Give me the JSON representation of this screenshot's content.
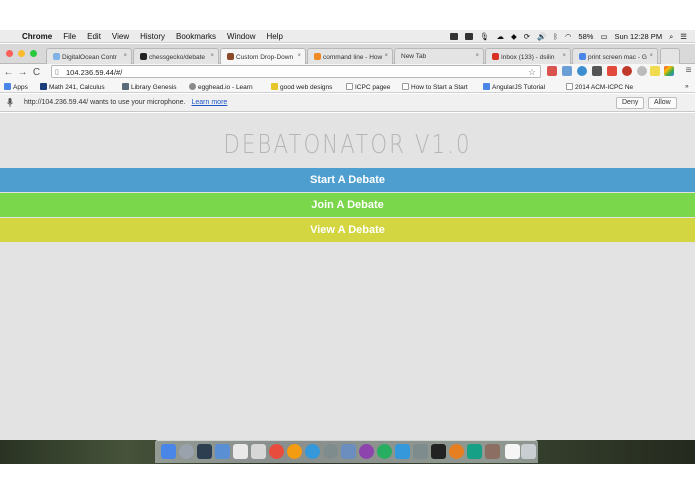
{
  "menubar": {
    "app_name": "Chrome",
    "items": [
      "File",
      "Edit",
      "View",
      "History",
      "Bookmarks",
      "Window",
      "Help"
    ],
    "battery": "58%",
    "clock": "Sun 12:28 PM"
  },
  "tabs": [
    {
      "label": "DigitalOcean Contr",
      "icon_color": "#7fb3e6"
    },
    {
      "label": "chessgecko/debate",
      "icon_color": "#222222"
    },
    {
      "label": "Custom Drop-Down",
      "icon_color": "#8a4a2a"
    },
    {
      "label": "command line - How",
      "icon_color": "#f08a24"
    },
    {
      "label": "New Tab",
      "icon_color": "#dcdcdc"
    },
    {
      "label": "Inbox (133) - dsilin",
      "icon_color": "#d93025"
    },
    {
      "label": "print screen mac - G",
      "icon_color": "#4a86e8"
    }
  ],
  "toolbar": {
    "url": "104.236.59.44/#/"
  },
  "bookmarks": [
    {
      "label": "Apps",
      "color": "#4a86e8"
    },
    {
      "label": "Math 241, Calculus",
      "color": "#1b3e7a"
    },
    {
      "label": "Library Genesis",
      "color": "#5a6a7a"
    },
    {
      "label": "egghead.io - Learn",
      "color": "#8a8a8a"
    },
    {
      "label": "good web designs",
      "color": "#e8c62a"
    },
    {
      "label": "ICPC pagee",
      "color": "#cfcfcf"
    },
    {
      "label": "How to Start a Start",
      "color": "#cfcfcf"
    },
    {
      "label": "AngularJS Tutorial",
      "color": "#4a86e8"
    },
    {
      "label": "2014 ACM-ICPC Ne",
      "color": "#cfcfcf"
    }
  ],
  "infobar": {
    "message": "http://104.236.59.44/ wants to use your microphone.",
    "learn_more": "Learn more",
    "deny": "Deny",
    "allow": "Allow"
  },
  "page": {
    "title": "DEBATONATOR V1.0",
    "buttons": [
      {
        "label": "Start A Debate",
        "color": "#4e9fcf"
      },
      {
        "label": "Join A Debate",
        "color": "#7ad64b"
      },
      {
        "label": "View A Debate",
        "color": "#d3d640"
      }
    ]
  },
  "colors": {
    "page_background": "#e3e3e3",
    "title": "#b6b6b6"
  }
}
